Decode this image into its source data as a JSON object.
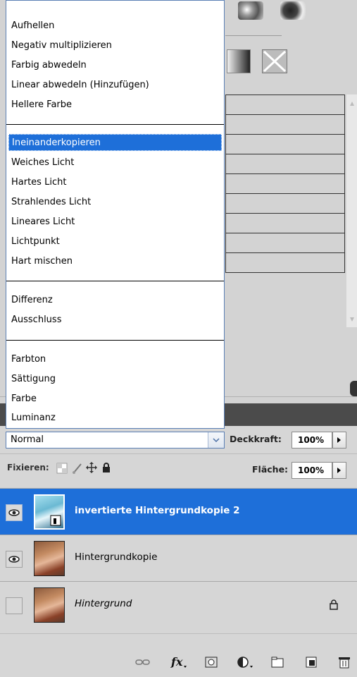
{
  "blend_menu": {
    "groups": [
      [
        "Aufhellen",
        "Negativ multiplizieren",
        "Farbig abwedeln",
        "Linear abwedeln (Hinzufügen)",
        "Hellere Farbe"
      ],
      [
        "Ineinanderkopieren",
        "Weiches Licht",
        "Hartes Licht",
        "Strahlendes Licht",
        "Lineares Licht",
        "Lichtpunkt",
        "Hart mischen"
      ],
      [
        "Differenz",
        "Ausschluss"
      ],
      [
        "Farbton",
        "Sättigung",
        "Farbe",
        "Luminanz"
      ]
    ],
    "highlighted": "Ineinanderkopieren"
  },
  "blend_select": {
    "value": "Normal"
  },
  "opacity": {
    "label": "Deckkraft:",
    "value": "100%"
  },
  "lock": {
    "label": "Fixieren:"
  },
  "fill": {
    "label": "Fläche:",
    "value": "100%"
  },
  "layers": [
    {
      "name": "invertierte Hintergrundkopie 2",
      "visible": true,
      "active": true,
      "locked": false
    },
    {
      "name": "Hintergrundkopie",
      "visible": true,
      "active": false,
      "locked": false
    },
    {
      "name": "Hintergrund",
      "visible": false,
      "active": false,
      "locked": true,
      "italic": true
    }
  ],
  "footer_icons": [
    "link-icon",
    "fx-icon",
    "mask-icon",
    "adjustment-icon",
    "folder-icon",
    "new-layer-icon",
    "trash-icon"
  ],
  "colors": {
    "selection": "#1e6fd9",
    "panel": "#d6d6d6"
  }
}
